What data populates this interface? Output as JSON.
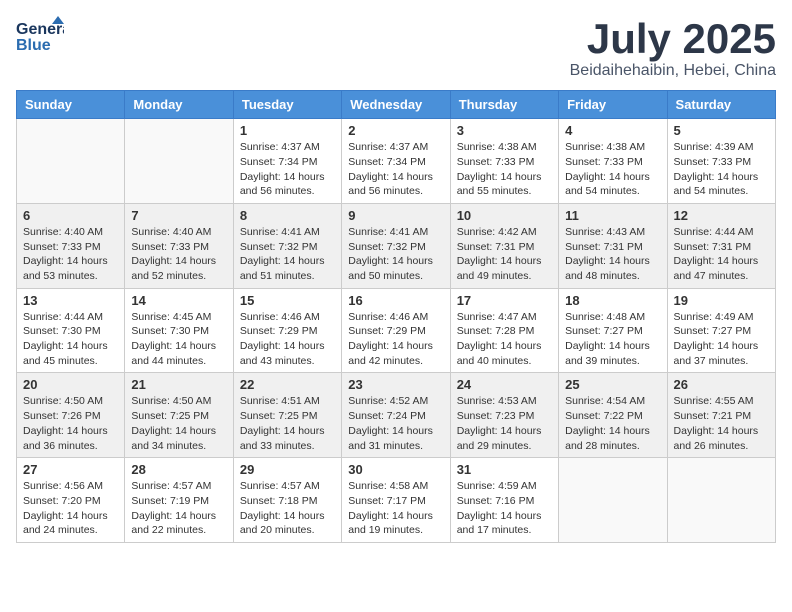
{
  "header": {
    "logo_general": "General",
    "logo_blue": "Blue",
    "month": "July 2025",
    "location": "Beidaihehaibin, Hebei, China"
  },
  "weekdays": [
    "Sunday",
    "Monday",
    "Tuesday",
    "Wednesday",
    "Thursday",
    "Friday",
    "Saturday"
  ],
  "weeks": [
    [
      {
        "day": "",
        "info": ""
      },
      {
        "day": "",
        "info": ""
      },
      {
        "day": "1",
        "info": "Sunrise: 4:37 AM\nSunset: 7:34 PM\nDaylight: 14 hours\nand 56 minutes."
      },
      {
        "day": "2",
        "info": "Sunrise: 4:37 AM\nSunset: 7:34 PM\nDaylight: 14 hours\nand 56 minutes."
      },
      {
        "day": "3",
        "info": "Sunrise: 4:38 AM\nSunset: 7:33 PM\nDaylight: 14 hours\nand 55 minutes."
      },
      {
        "day": "4",
        "info": "Sunrise: 4:38 AM\nSunset: 7:33 PM\nDaylight: 14 hours\nand 54 minutes."
      },
      {
        "day": "5",
        "info": "Sunrise: 4:39 AM\nSunset: 7:33 PM\nDaylight: 14 hours\nand 54 minutes."
      }
    ],
    [
      {
        "day": "6",
        "info": "Sunrise: 4:40 AM\nSunset: 7:33 PM\nDaylight: 14 hours\nand 53 minutes."
      },
      {
        "day": "7",
        "info": "Sunrise: 4:40 AM\nSunset: 7:33 PM\nDaylight: 14 hours\nand 52 minutes."
      },
      {
        "day": "8",
        "info": "Sunrise: 4:41 AM\nSunset: 7:32 PM\nDaylight: 14 hours\nand 51 minutes."
      },
      {
        "day": "9",
        "info": "Sunrise: 4:41 AM\nSunset: 7:32 PM\nDaylight: 14 hours\nand 50 minutes."
      },
      {
        "day": "10",
        "info": "Sunrise: 4:42 AM\nSunset: 7:31 PM\nDaylight: 14 hours\nand 49 minutes."
      },
      {
        "day": "11",
        "info": "Sunrise: 4:43 AM\nSunset: 7:31 PM\nDaylight: 14 hours\nand 48 minutes."
      },
      {
        "day": "12",
        "info": "Sunrise: 4:44 AM\nSunset: 7:31 PM\nDaylight: 14 hours\nand 47 minutes."
      }
    ],
    [
      {
        "day": "13",
        "info": "Sunrise: 4:44 AM\nSunset: 7:30 PM\nDaylight: 14 hours\nand 45 minutes."
      },
      {
        "day": "14",
        "info": "Sunrise: 4:45 AM\nSunset: 7:30 PM\nDaylight: 14 hours\nand 44 minutes."
      },
      {
        "day": "15",
        "info": "Sunrise: 4:46 AM\nSunset: 7:29 PM\nDaylight: 14 hours\nand 43 minutes."
      },
      {
        "day": "16",
        "info": "Sunrise: 4:46 AM\nSunset: 7:29 PM\nDaylight: 14 hours\nand 42 minutes."
      },
      {
        "day": "17",
        "info": "Sunrise: 4:47 AM\nSunset: 7:28 PM\nDaylight: 14 hours\nand 40 minutes."
      },
      {
        "day": "18",
        "info": "Sunrise: 4:48 AM\nSunset: 7:27 PM\nDaylight: 14 hours\nand 39 minutes."
      },
      {
        "day": "19",
        "info": "Sunrise: 4:49 AM\nSunset: 7:27 PM\nDaylight: 14 hours\nand 37 minutes."
      }
    ],
    [
      {
        "day": "20",
        "info": "Sunrise: 4:50 AM\nSunset: 7:26 PM\nDaylight: 14 hours\nand 36 minutes."
      },
      {
        "day": "21",
        "info": "Sunrise: 4:50 AM\nSunset: 7:25 PM\nDaylight: 14 hours\nand 34 minutes."
      },
      {
        "day": "22",
        "info": "Sunrise: 4:51 AM\nSunset: 7:25 PM\nDaylight: 14 hours\nand 33 minutes."
      },
      {
        "day": "23",
        "info": "Sunrise: 4:52 AM\nSunset: 7:24 PM\nDaylight: 14 hours\nand 31 minutes."
      },
      {
        "day": "24",
        "info": "Sunrise: 4:53 AM\nSunset: 7:23 PM\nDaylight: 14 hours\nand 29 minutes."
      },
      {
        "day": "25",
        "info": "Sunrise: 4:54 AM\nSunset: 7:22 PM\nDaylight: 14 hours\nand 28 minutes."
      },
      {
        "day": "26",
        "info": "Sunrise: 4:55 AM\nSunset: 7:21 PM\nDaylight: 14 hours\nand 26 minutes."
      }
    ],
    [
      {
        "day": "27",
        "info": "Sunrise: 4:56 AM\nSunset: 7:20 PM\nDaylight: 14 hours\nand 24 minutes."
      },
      {
        "day": "28",
        "info": "Sunrise: 4:57 AM\nSunset: 7:19 PM\nDaylight: 14 hours\nand 22 minutes."
      },
      {
        "day": "29",
        "info": "Sunrise: 4:57 AM\nSunset: 7:18 PM\nDaylight: 14 hours\nand 20 minutes."
      },
      {
        "day": "30",
        "info": "Sunrise: 4:58 AM\nSunset: 7:17 PM\nDaylight: 14 hours\nand 19 minutes."
      },
      {
        "day": "31",
        "info": "Sunrise: 4:59 AM\nSunset: 7:16 PM\nDaylight: 14 hours\nand 17 minutes."
      },
      {
        "day": "",
        "info": ""
      },
      {
        "day": "",
        "info": ""
      }
    ]
  ]
}
